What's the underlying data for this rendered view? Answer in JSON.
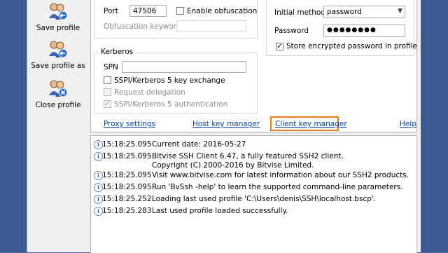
{
  "sidebar": {
    "items": [
      {
        "label": "Save profile",
        "icon": "save-profile-icon"
      },
      {
        "label": "Save profile as",
        "icon": "save-profile-as-icon"
      },
      {
        "label": "Close profile",
        "icon": "close-profile-icon"
      }
    ]
  },
  "proxy_section": {
    "port_label": "Port",
    "port_value": "47506",
    "obfuscation_label": "Enable obfuscation",
    "obfuscation_checked": false,
    "keyword_label": "Obfuscation keyword",
    "keyword_value": ""
  },
  "kerberos": {
    "title": "Kerberos",
    "spn_label": "SPN",
    "spn_value": "",
    "sspi_kex_label": "SSPI/Kerberos 5 key exchange",
    "sspi_kex_checked": false,
    "delegation_label": "Request delegation",
    "delegation_checked": false,
    "sspi_auth_label": "SSPI/Kerberos 5 authentication",
    "sspi_auth_checked": true
  },
  "auth": {
    "method_label": "Initial method",
    "method_value": "password",
    "password_label": "Password",
    "password_value": "●●●●●●●●",
    "store_label": "Store encrypted password in profile",
    "store_checked": true
  },
  "links": {
    "proxy": "Proxy settings",
    "host_key": "Host key manager",
    "client_key": "Client key manager",
    "help": "Help"
  },
  "log": [
    {
      "time": "15:18:25.095",
      "lines": [
        "Current date: 2016-05-27"
      ]
    },
    {
      "time": "15:18:25.095",
      "lines": [
        "Bitvise SSH Client 6.47, a fully featured SSH2 client.",
        "Copyright (C) 2000-2016 by Bitvise Limited."
      ]
    },
    {
      "time": "15:18:25.095",
      "lines": [
        "Visit www.bitvise.com for latest information about our SSH2 products."
      ]
    },
    {
      "time": "15:18:25.095",
      "lines": [
        "Run 'BvSsh -help' to learn the supported command-line parameters."
      ]
    },
    {
      "time": "15:18:25.252",
      "lines": [
        "Loading last used profile 'C:\\Users\\denis\\SSH\\localhost.bscp'."
      ]
    },
    {
      "time": "15:18:25.283",
      "lines": [
        "Last used profile loaded successfully."
      ]
    }
  ],
  "colors": {
    "background": "#4a6aa3",
    "highlight": "#f07e1b",
    "link": "#0645ad"
  }
}
